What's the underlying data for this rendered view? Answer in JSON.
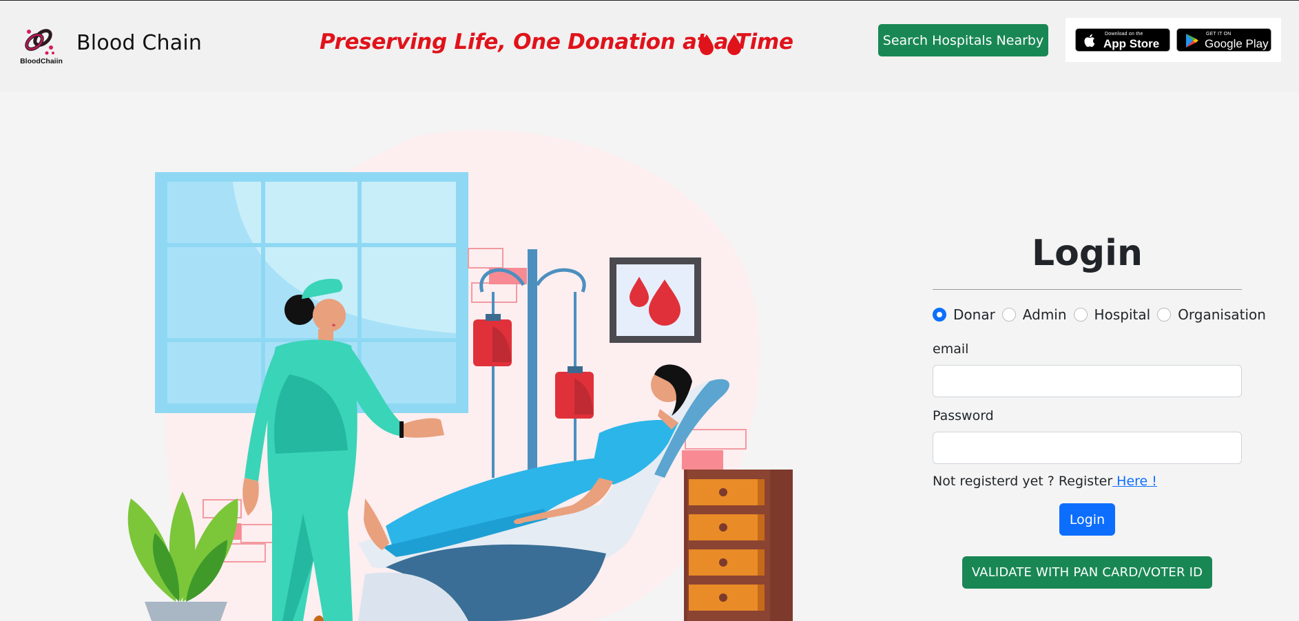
{
  "header": {
    "brand": "Blood Chain",
    "logo_text": "BloodChaiin",
    "tagline": "Preserving Life, One Donation at a Time",
    "search_button": "Search Hospitals Nearby",
    "app_store": {
      "small": "Download on the",
      "big": "App Store"
    },
    "google_play": {
      "small": "GET IT ON",
      "big": "Google Play"
    }
  },
  "login": {
    "title": "Login",
    "roles": [
      {
        "label": "Donar",
        "checked": true
      },
      {
        "label": "Admin",
        "checked": false
      },
      {
        "label": "Hospital",
        "checked": false
      },
      {
        "label": "Organisation",
        "checked": false
      }
    ],
    "email_label": "email",
    "email_value": "",
    "password_label": "Password",
    "password_value": "",
    "register_prefix": "Not registerd yet ? Register",
    "register_link": " Here !",
    "login_button": "Login",
    "validate_button": "VALIDATE WITH PAN CARD/VOTER ID"
  },
  "colors": {
    "tagline": "#e0131b",
    "primary": "#0d6efd",
    "success": "#198754",
    "blood": "#e0313a"
  },
  "icons": [
    "blood-chain-logo-icon",
    "blood-drop-icon",
    "apple-icon",
    "google-play-icon"
  ]
}
